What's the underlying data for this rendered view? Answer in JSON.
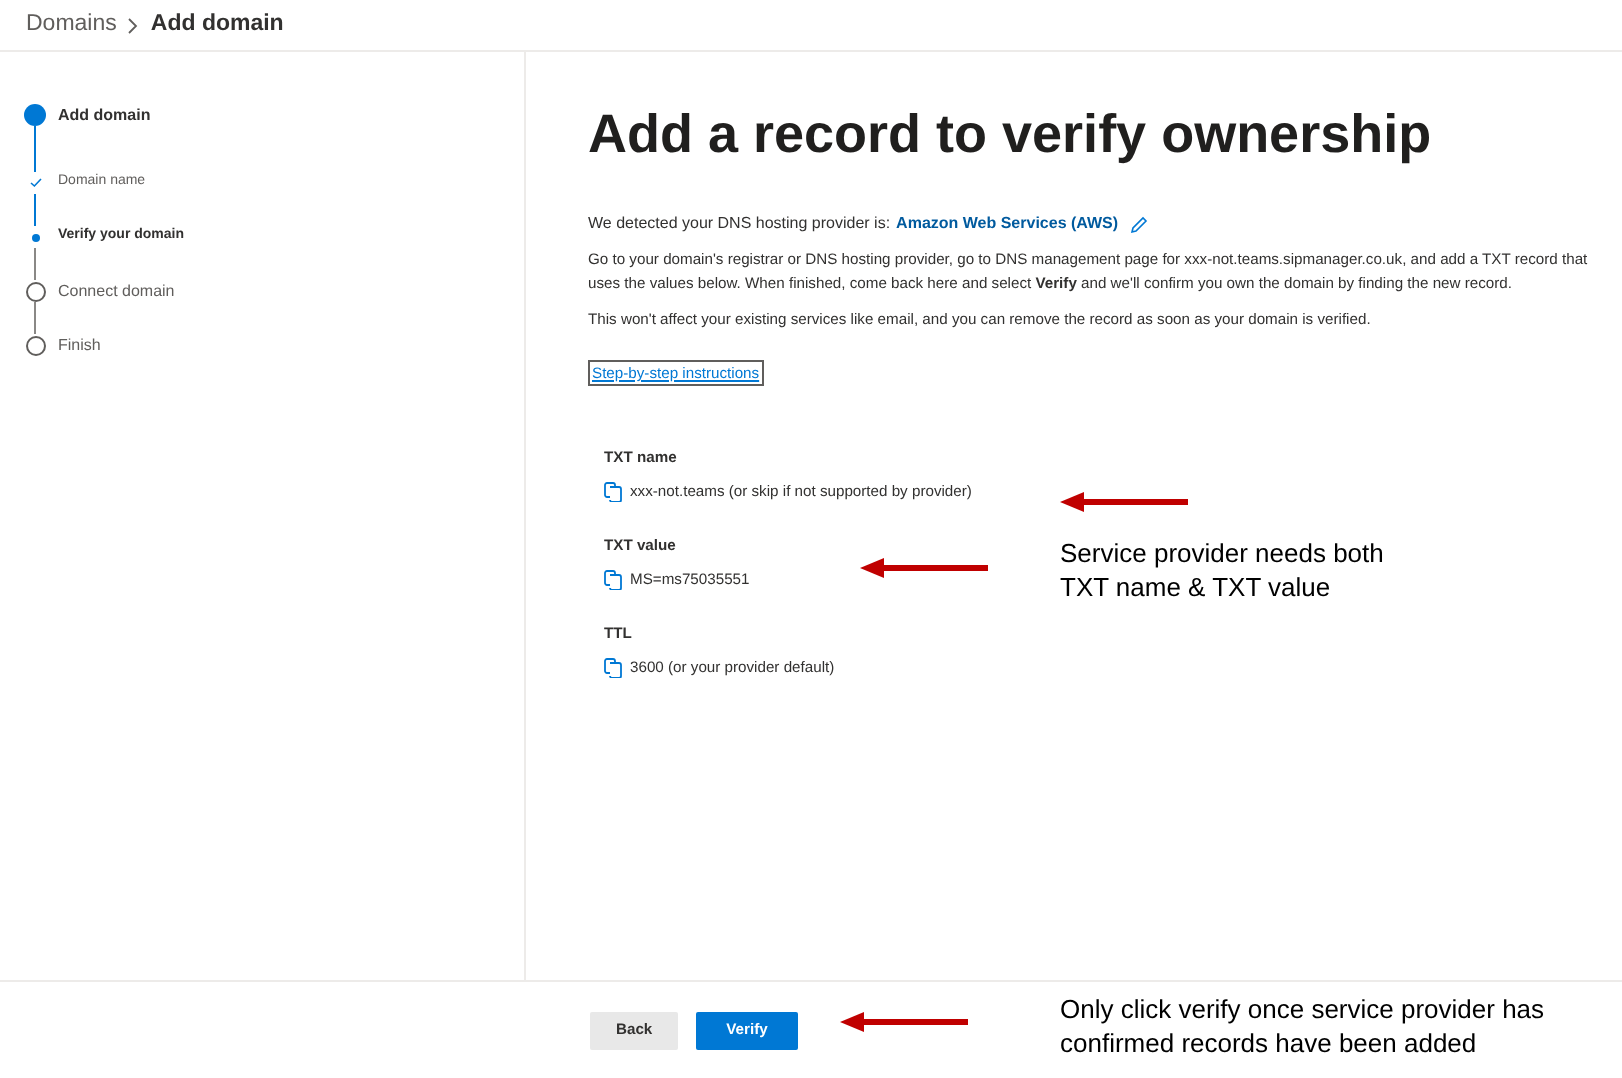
{
  "breadcrumb": [
    {
      "label": "Domains",
      "current": false
    },
    {
      "label": "Add domain",
      "current": true
    }
  ],
  "steps": [
    {
      "label": "Add domain",
      "kind": "step",
      "done": true,
      "current": false
    },
    {
      "label": "Domain name",
      "kind": "substep",
      "done": true,
      "current": false
    },
    {
      "label": "Verify your domain",
      "kind": "substep",
      "done": false,
      "current": true
    },
    {
      "label": "Connect domain",
      "kind": "step",
      "done": false,
      "current": false
    },
    {
      "label": "Finish",
      "kind": "step",
      "done": false,
      "current": false
    }
  ],
  "title": "Add a record to verify ownership",
  "provider": {
    "prefix": "We detected your DNS hosting provider is:",
    "name": "Amazon Web Services (AWS)"
  },
  "paragraphs": [
    "Go to your domain's registrar or DNS hosting provider, go to DNS management page for xxx-not.teams.sipmanager.co.uk, and add a TXT record that uses the values below. When finished, come back here and select **Verify** and we'll confirm you own the domain by finding the new record.",
    "This won't affect your existing services like email, and you can remove the record as soon as your domain is verified."
  ],
  "link": "Step-by-step instructions",
  "records": [
    {
      "label": "TXT name",
      "value": "xxx-not.teams (or skip if not supported by provider)"
    },
    {
      "label": "TXT value",
      "value": "MS=ms75035551"
    },
    {
      "label": "TTL",
      "value": "3600 (or your provider default)"
    }
  ],
  "buttons": [
    {
      "label": "Back",
      "kind": "secondary"
    },
    {
      "label": "Verify",
      "kind": "primary"
    }
  ],
  "annotations": [
    "Service provider needs both TXT name & TXT value",
    "Only click verify once service provider has confirmed records have been added"
  ]
}
